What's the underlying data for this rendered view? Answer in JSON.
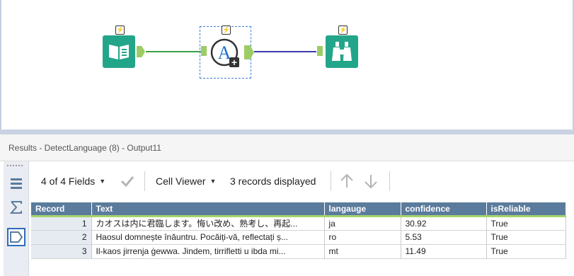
{
  "canvas": {
    "tools": [
      {
        "name": "text-input-tool",
        "badge": "⚡"
      },
      {
        "name": "detect-language-tool",
        "badge": "⚡",
        "glyph": "A",
        "plus": "+"
      },
      {
        "name": "browse-tool",
        "badge": "⚡"
      }
    ],
    "colors": {
      "tool_green": "#23a58a",
      "anchor_green": "#9ccc65",
      "connection_green": "#3aa04a",
      "connection_blue": "#3a3aa8",
      "selection": "#3c7fd6"
    }
  },
  "results": {
    "title": "Results - DetectLanguage (8) - Output11",
    "toolbar": {
      "fields_label": "4 of 4 Fields",
      "viewer_label": "Cell Viewer",
      "records_label": "3 records displayed"
    },
    "columns": [
      "Record",
      "Text",
      "langauge",
      "confidence",
      "isReliable"
    ],
    "rows": [
      {
        "record": "1",
        "text": "カオスは内に君臨します。悔い改め、熟考し、再起...",
        "language": "ja",
        "confidence": "30.92",
        "reliable": "True"
      },
      {
        "record": "2",
        "text": "Haosul domnește înăuntru. Pocăiți-vă, reflectați ș...",
        "language": "ro",
        "confidence": "5.53",
        "reliable": "True"
      },
      {
        "record": "3",
        "text": "Il-kaos jirrenja ġewwa. Jindem, tirrifletti u ibda mi...",
        "language": "mt",
        "confidence": "11.49",
        "reliable": "True"
      }
    ]
  }
}
